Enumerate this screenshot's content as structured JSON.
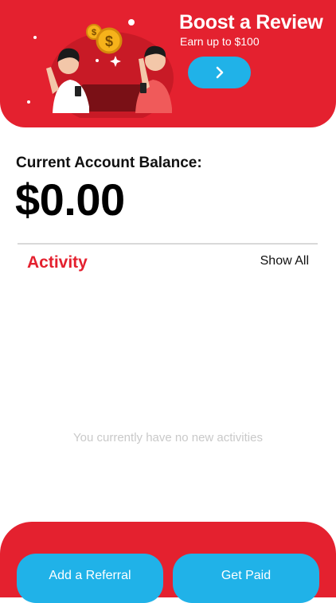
{
  "banner": {
    "title": "Boost a Review",
    "subtitle": "Earn up to $100",
    "button_icon": "chevron-right-icon"
  },
  "balance": {
    "label": "Current Account Balance:",
    "value": "$0.00"
  },
  "activity": {
    "title": "Activity",
    "show_all": "Show All",
    "empty_message": "You currently have no new activities"
  },
  "actions": {
    "add_referral": "Add a Referral",
    "get_paid": "Get Paid"
  },
  "colors": {
    "brand_red": "#e4212f",
    "accent_blue": "#20b2e8"
  }
}
